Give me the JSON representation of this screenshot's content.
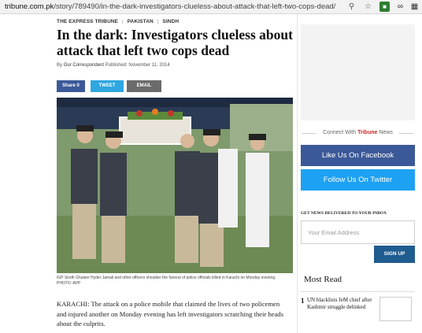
{
  "browser": {
    "url_host": "tribune.com.pk",
    "url_path": "/story/789490/in-the-dark-investigators-clueless-about-attack-that-left-two-cops-dead/"
  },
  "article": {
    "breadcrumb": [
      "THE EXPRESS TRIBUNE",
      "PAKISTAN",
      "SINDH"
    ],
    "headline": "In the dark: Investigators clueless about attack that left two cops dead",
    "byline_prefix": "By",
    "author": "Our Correspondent",
    "published": "Published: November 11, 2014",
    "share": {
      "facebook": "Share 0",
      "twitter": "TWEET",
      "email": "EMAIL"
    },
    "photo_caption": "IGP Sindh Ghulam Hyder Jamali and other officers shoulder the funeral of police officials killed in Karachi on Monday evening. PHOTO: APP",
    "body": "KARACHI: The attack on a police mobile that claimed the lives of two policemen and injured another on Monday evening has left investigators scratching their heads about the culprits."
  },
  "sidebar": {
    "connect_prefix": "Connect With",
    "connect_brand": "Tribune",
    "connect_suffix": "News",
    "facebook_button": "Like Us On Facebook",
    "twitter_button": "Follow Us On Twitter",
    "inbox_title": "GET NEWS DELIVERED TO YOUR INBOX",
    "email_placeholder": "Your Email Address",
    "signup_button": "SIGN UP",
    "most_read_title": "Most Read",
    "most_read": [
      {
        "num": "1",
        "title": "UN blacklists JeM chief after Kashmir struggle delinked"
      }
    ]
  },
  "icons": {
    "search": "search-icon",
    "star": "bookmark-star-icon",
    "ext1": "extension-icon",
    "ext2": "link-extension-icon",
    "ext3": "grid-extension-icon"
  },
  "colors": {
    "facebook": "#3b5998",
    "twitter": "#1da1f2",
    "brand_red": "#c62828",
    "signup": "#1f5c8f"
  }
}
